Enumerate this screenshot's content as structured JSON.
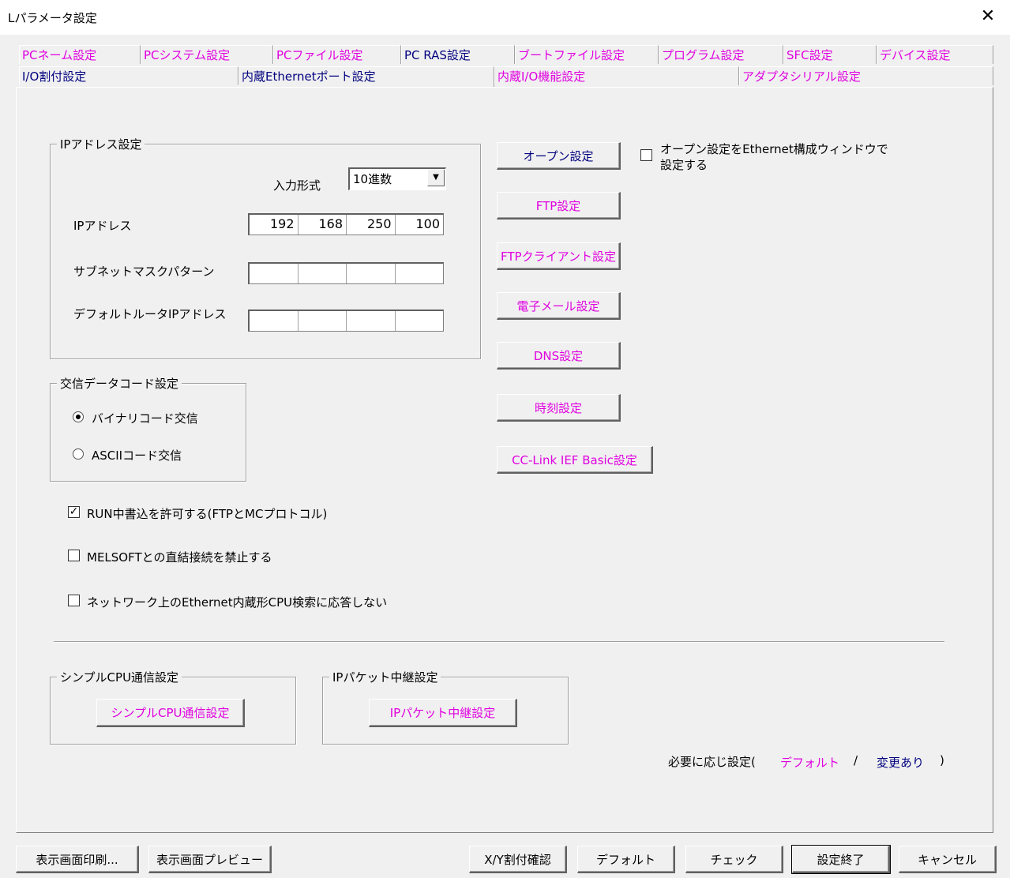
{
  "window": {
    "title": "Lパラメータ設定",
    "close": "✕"
  },
  "tabs_row1": [
    {
      "label": "PCネーム設定",
      "style": "mag"
    },
    {
      "label": "PCシステム設定",
      "style": "mag"
    },
    {
      "label": "PCファイル設定",
      "style": "mag"
    },
    {
      "label": "PC RAS設定",
      "style": "blk"
    },
    {
      "label": "ブートファイル設定",
      "style": "mag"
    },
    {
      "label": "プログラム設定",
      "style": "mag"
    },
    {
      "label": "SFC設定",
      "style": "mag"
    },
    {
      "label": "デバイス設定",
      "style": "mag"
    }
  ],
  "tabs_row2": [
    {
      "label": "I/O割付設定",
      "style": "blk"
    },
    {
      "label": "内蔵Ethernetポート設定",
      "style": "active"
    },
    {
      "label": "内蔵I/O機能設定",
      "style": "mag"
    },
    {
      "label": "アダプタシリアル設定",
      "style": "mag"
    }
  ],
  "ip_group": {
    "title": "IPアドレス設定",
    "input_format_label": "入力形式",
    "input_format_value": "10進数",
    "ip_label": "IPアドレス",
    "ip": [
      "192",
      "168",
      "250",
      "100"
    ],
    "subnet_label": "サブネットマスクパターン",
    "subnet": [
      "",
      "",
      "",
      ""
    ],
    "gateway_label": "デフォルトルータIPアドレス",
    "gateway": [
      "",
      "",
      "",
      ""
    ]
  },
  "code_group": {
    "title": "交信データコード設定",
    "binary": "バイナリコード交信",
    "ascii": "ASCIIコード交信",
    "selected": "binary"
  },
  "side_buttons": {
    "open": "オープン設定",
    "ftp": "FTP設定",
    "ftp_client": "FTPクライアント設定",
    "email": "電子メール設定",
    "dns": "DNS設定",
    "time": "時刻設定",
    "cclink": "CC-Link IEF Basic設定"
  },
  "open_ethernet_check": {
    "line1": "オープン設定をEthernet構成ウィンドウで",
    "line2": "設定する",
    "checked": false
  },
  "checks": {
    "run_write": {
      "label": "RUN中書込を許可する(FTPとMCプロトコル)",
      "checked": true
    },
    "melsoft": {
      "label": "MELSOFTとの直結接続を禁止する",
      "checked": false
    },
    "search": {
      "label": "ネットワーク上のEthernet内蔵形CPU検索に応答しない",
      "checked": false
    }
  },
  "simple_group": {
    "title": "シンプルCPU通信設定",
    "button": "シンプルCPU通信設定"
  },
  "relay_group": {
    "title": "IPパケット中継設定",
    "button": "IPパケット中継設定"
  },
  "legend": {
    "prefix": "必要に応じ設定(",
    "default": "デフォルト",
    "slash": "/",
    "changed": "変更あり",
    "suffix": ")"
  },
  "footer": {
    "print": "表示画面印刷...",
    "preview": "表示画面プレビュー",
    "xy": "X/Y割付確認",
    "default": "デフォルト",
    "check": "チェック",
    "finish": "設定終了",
    "cancel": "キャンセル"
  },
  "colors": {
    "magenta": "#e000e0",
    "navy": "#00007f",
    "face": "#f0f0f0"
  }
}
